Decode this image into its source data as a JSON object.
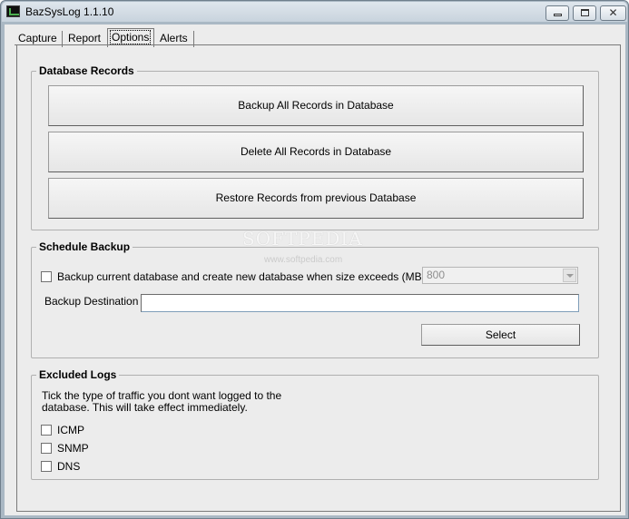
{
  "window": {
    "title": "BazSysLog 1.1.10"
  },
  "tabs": [
    {
      "label": "Capture",
      "active": false
    },
    {
      "label": "Report",
      "active": false
    },
    {
      "label": "Options",
      "active": true
    },
    {
      "label": "Alerts",
      "active": false
    }
  ],
  "database_records": {
    "title": "Database Records",
    "backup_label": "Backup All Records in Database",
    "delete_label": "Delete All Records in Database",
    "restore_label": "Restore Records from previous Database"
  },
  "schedule_backup": {
    "title": "Schedule Backup",
    "checkbox_label": "Backup current database and create new database when size exceeds (MBs)",
    "checked": false,
    "size_value": "800",
    "destination_label": "Backup Destination",
    "destination_value": "",
    "select_label": "Select"
  },
  "excluded_logs": {
    "title": "Excluded Logs",
    "description_line1": "Tick the type of traffic you dont want logged to the",
    "description_line2": "database. This will take effect immediately.",
    "items": [
      {
        "label": "ICMP",
        "checked": false
      },
      {
        "label": "SNMP",
        "checked": false
      },
      {
        "label": "DNS",
        "checked": false
      }
    ]
  },
  "watermark": {
    "brand": "SOFTPEDIA",
    "url": "www.softpedia.com"
  }
}
